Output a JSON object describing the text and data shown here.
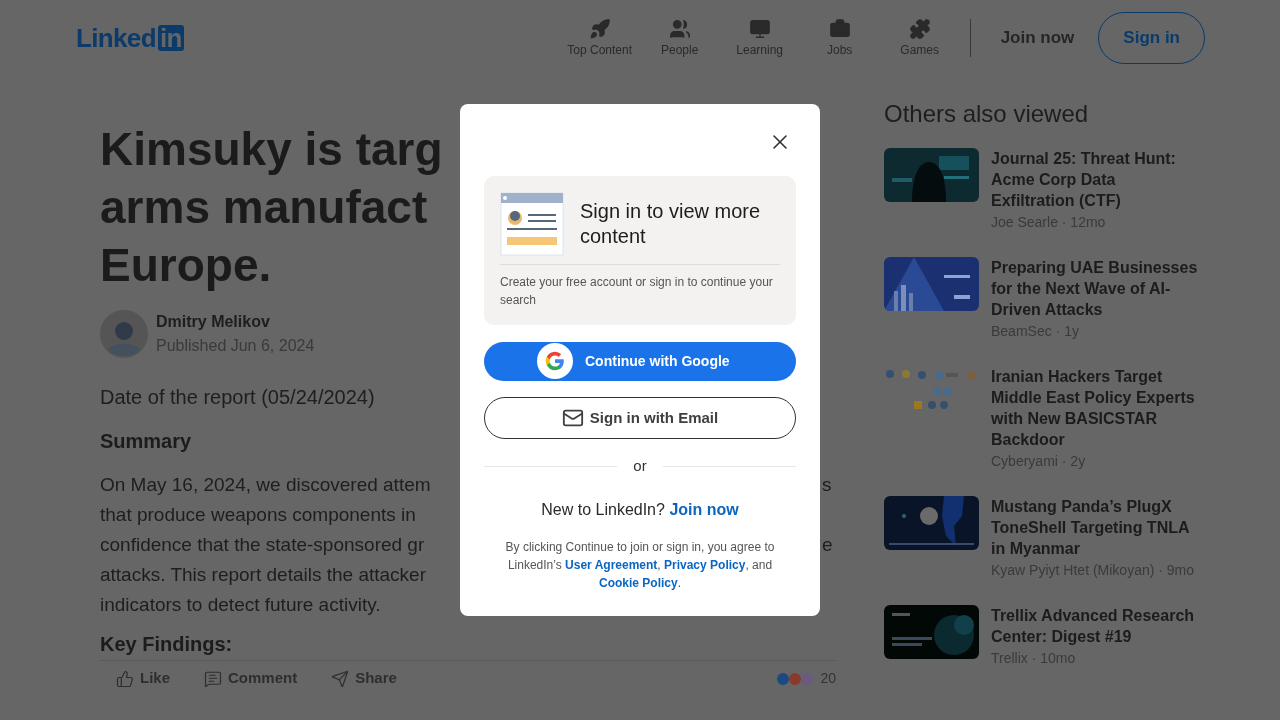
{
  "header": {
    "logo": {
      "word": "Linked",
      "badge": "in"
    },
    "nav": [
      {
        "label": "Top Content",
        "kind": "rocket"
      },
      {
        "label": "People",
        "kind": "people"
      },
      {
        "label": "Learning",
        "kind": "learning"
      },
      {
        "label": "Jobs",
        "kind": "jobs"
      },
      {
        "label": "Games",
        "kind": "games"
      }
    ],
    "join": "Join now",
    "sign_in": "Sign in"
  },
  "article": {
    "title_lines": [
      {
        "left": "Kimsuky is targ"
      },
      {
        "left": "arms manufact"
      },
      {
        "left": "Europe."
      }
    ],
    "author": {
      "name": "Dmitry Melikov",
      "published": "Published Jun 6, 2024"
    },
    "date": "Date of the report (05/24/2024)",
    "summary_heading": "Summary",
    "paragraph_lines": [
      {
        "left": "On May 16, 2024, we discovered attem",
        "right": "s"
      },
      {
        "left": "that produce weapons components in"
      },
      {
        "left": "confidence that the state-sponsored gr",
        "right": "e"
      },
      {
        "left": "attacks. This report details the attacker"
      },
      {
        "left": "indicators to detect future activity."
      }
    ],
    "next_heading": "Key Findings:",
    "actions": [
      {
        "label": "Like",
        "kind": "like"
      },
      {
        "label": "Comment",
        "kind": "comment"
      },
      {
        "label": "Share",
        "kind": "share"
      }
    ],
    "reaction_count": "20"
  },
  "sidebar": {
    "title": "Others also viewed",
    "separator": "·",
    "items": [
      {
        "title": "Journal 25: Threat Hunt: Acme Corp Data Exfiltration (CTF)",
        "author": "Joe Searle",
        "age": "12mo",
        "kind": "hacker"
      },
      {
        "title": "Preparing UAE Businesses for the Next Wave of AI-Driven Attacks",
        "author": "BeamSec",
        "age": "1y",
        "kind": "city"
      },
      {
        "title": "Iranian Hackers Target Middle East Policy Experts with New BASICSTAR Backdoor",
        "author": "Cyberyami",
        "age": "2y",
        "kind": "diagram"
      },
      {
        "title": "Mustang Panda’s PlugX ToneShell Targeting TNLA in Myanmar",
        "author": "Kyaw Pyiyt Htet (Mikoyan)",
        "age": "9mo",
        "kind": "map"
      },
      {
        "title": "Trellix Advanced Research Center: Digest #19",
        "author": "Trellix",
        "age": "10mo",
        "kind": "space"
      }
    ]
  },
  "modal": {
    "heading": "Sign in to view more content",
    "subtext": "Create your free account or sign in to continue your search",
    "google": "Continue with Google",
    "email": "Sign in with Email",
    "or": "or",
    "new_prompt": "New to LinkedIn?",
    "join": "Join now",
    "legal": "By clicking Continue to join or sign in, you agree to LinkedIn’s",
    "links": [
      "User Agreement",
      "Privacy Policy",
      "Cookie Policy"
    ],
    "legal_comma": ",",
    "legal_and": ", and",
    "legal_end": "."
  }
}
